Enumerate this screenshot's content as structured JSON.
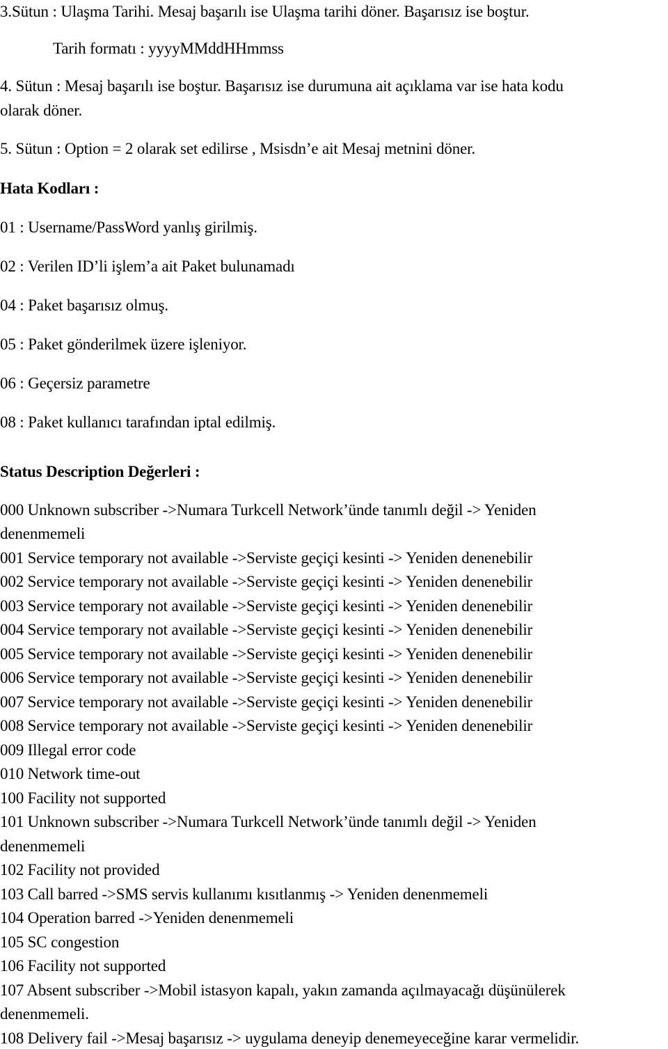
{
  "document": {
    "intro": {
      "col3": "3.Sütun :  Ulaşma Tarihi. Mesaj başarılı ise Ulaşma tarihi döner. Başarısız ise boştur.",
      "date_format": "Tarih formatı  : yyyyMMddHHmmss",
      "col4_line1": "4. Sütun : Mesaj başarılı ise boştur. Başarısız ise durumuna ait açıklama var ise hata kodu",
      "col4_line2": "olarak döner.",
      "col5": "5. Sütun : Option = 2 olarak set edilirse , Msisdn’e ait Mesaj metnini döner."
    },
    "error_codes": {
      "heading": "Hata Kodları :",
      "items": [
        "01 : Username/PassWord yanlış girilmiş.",
        "02 : Verilen ID’li işlem’a ait Paket bulunamadı",
        "04 : Paket başarısız olmuş.",
        "05 : Paket gönderilmek üzere işleniyor.",
        "06 : Geçersiz parametre",
        "08 : Paket kullanıcı tarafından iptal edilmiş."
      ]
    },
    "status_descriptions": {
      "heading": "Status Description Değerleri :",
      "lines": [
        "000 Unknown subscriber ->Numara Turkcell Network’ünde tanımlı değil -> Yeniden",
        "denenmemeli",
        "001 Service temporary not available ->Serviste geçiçi kesinti -> Yeniden denenebilir",
        "002 Service temporary not available ->Serviste geçiçi kesinti -> Yeniden denenebilir",
        "003 Service temporary not available ->Serviste geçiçi kesinti -> Yeniden denenebilir",
        "004 Service temporary not available ->Serviste geçiçi kesinti -> Yeniden denenebilir",
        "005 Service temporary not available ->Serviste geçiçi kesinti -> Yeniden denenebilir",
        "006 Service temporary not available ->Serviste geçiçi kesinti -> Yeniden denenebilir",
        "007 Service temporary not available ->Serviste geçiçi kesinti -> Yeniden denenebilir",
        "008 Service temporary not available ->Serviste geçiçi kesinti -> Yeniden denenebilir",
        "009 Illegal error code",
        "010 Network time-out",
        "100 Facility not supported",
        "101 Unknown subscriber  ->Numara Turkcell Network’ünde tanımlı değil -> Yeniden",
        "denenmemeli",
        "102 Facility not provided",
        "103 Call barred ->SMS servis kullanımı kısıtlanmış -> Yeniden denenmemeli",
        "104 Operation barred  ->Yeniden denenmemeli",
        "105 SC congestion",
        "106 Facility not supported",
        "107 Absent subscriber ->Mobil istasyon kapalı, yakın zamanda açılmayacağı düşünülerek",
        "denenmemeli.",
        "108 Delivery fail ->Mesaj başarısız -> uygulama deneyip denemeyeceğine karar vermelidir."
      ]
    }
  }
}
